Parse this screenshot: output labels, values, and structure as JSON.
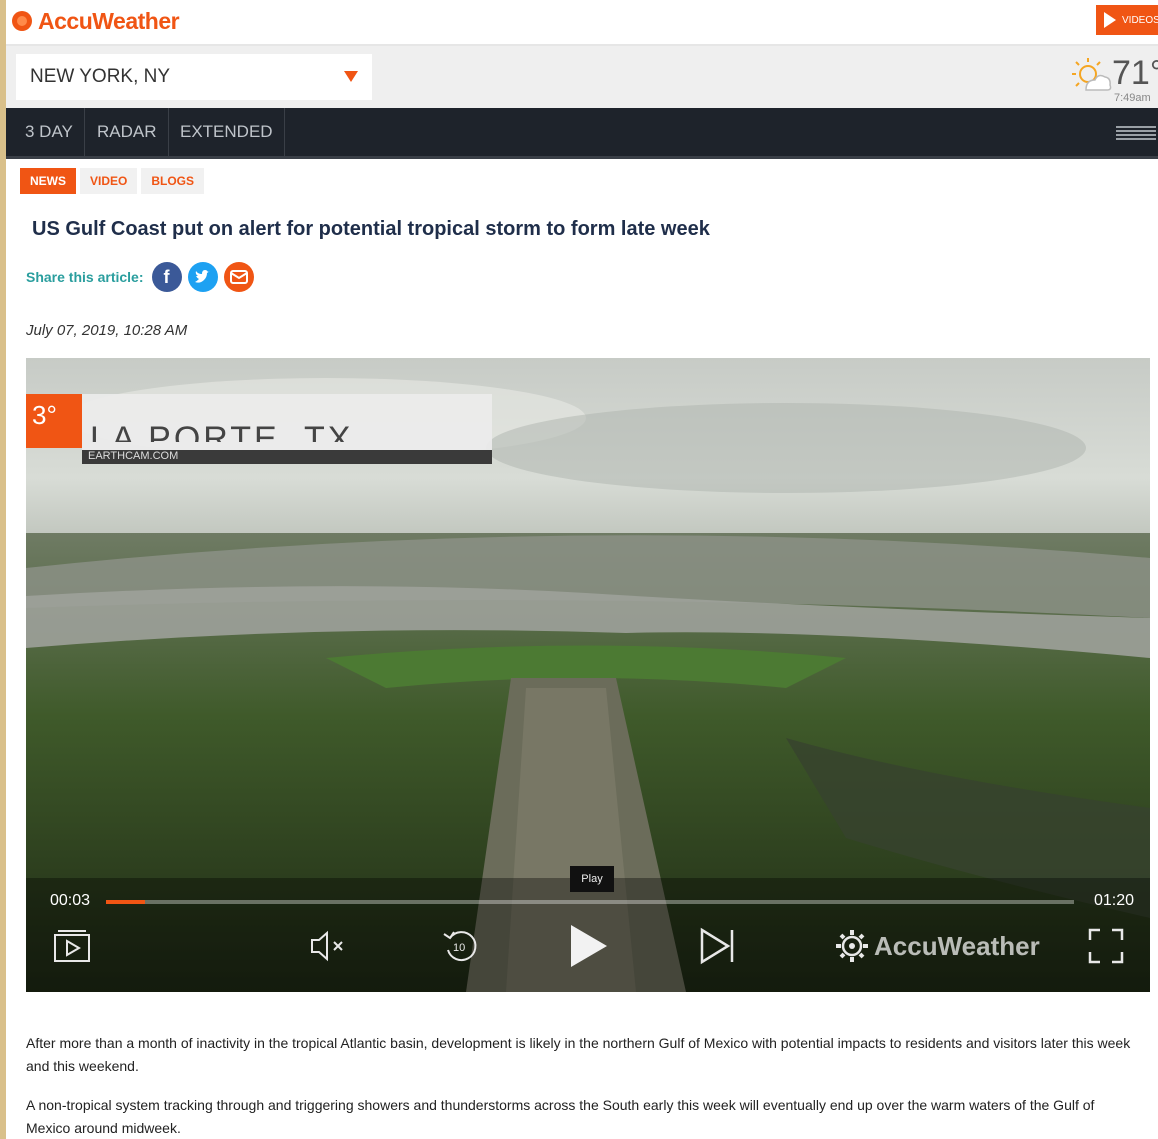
{
  "header": {
    "logo_text": "AccuWeather",
    "video_button_label": "VIDEOS",
    "brand_color": "#f05514"
  },
  "location_bar": {
    "selected_location": "NEW YORK, NY",
    "current_temp": "71°",
    "current_time": "7:49am",
    "weather_icon": "partly-sunny-icon"
  },
  "nav": {
    "items": [
      {
        "label": "3 DAY"
      },
      {
        "label": "RADAR"
      },
      {
        "label": "EXTENDED"
      }
    ],
    "menu_icon": "menu-icon"
  },
  "tabs": [
    {
      "label": "NEWS",
      "active": true
    },
    {
      "label": "VIDEO",
      "active": false
    },
    {
      "label": "BLOGS",
      "active": false
    }
  ],
  "article": {
    "headline": "US Gulf Coast put on alert for potential tropical storm to form late week",
    "share_label": "Share this article:",
    "share_icons": [
      "facebook-icon",
      "twitter-icon",
      "email-icon"
    ],
    "date": "July 07, 2019, 10:28 AM",
    "paragraphs": [
      "After more than a month of inactivity in the tropical Atlantic basin, development is likely in the northern Gulf of Mexico with potential impacts to residents and visitors later this week and this weekend.",
      "A non-tropical system tracking through and triggering showers and thunderstorms across the South early this week will eventually end up over the warm waters of the Gulf of Mexico around midweek."
    ]
  },
  "video": {
    "overlay_badge": "3°",
    "overlay_location": "LA PORTE, TX",
    "overlay_source": "EARTHCAM.COM",
    "tooltip": "Play",
    "current_time": "00:03",
    "total_time": "01:20",
    "progress_fraction": 0.04,
    "watermark": "AccuWeather"
  }
}
